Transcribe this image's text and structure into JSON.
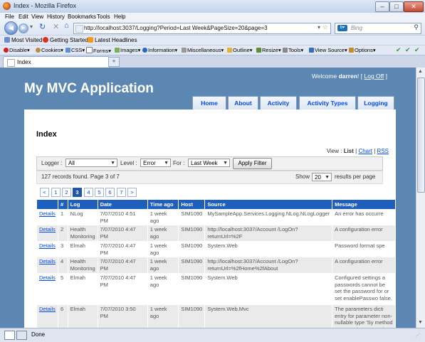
{
  "window": {
    "title": "Index - Mozilla Firefox",
    "buttons": {
      "minimize": "–",
      "maximize": "□",
      "close": "✕"
    }
  },
  "menu": [
    "File",
    "Edit",
    "View",
    "History",
    "Bookmarks",
    "Tools",
    "Help"
  ],
  "nav": {
    "url": "http://localhost:3037/Logging?Period=Last Week&PageSize=20&page=3",
    "search_placeholder": "Bing"
  },
  "bookmarks": [
    "Most Visited",
    "Getting Started",
    "Latest Headlines"
  ],
  "devtools": [
    "Disable",
    "Cookies",
    "CSS",
    "Forms",
    "Images",
    "Information",
    "Miscellaneous",
    "Outline",
    "Resize",
    "Tools",
    "View Source",
    "Options"
  ],
  "tab": {
    "label": "Index",
    "new_tab": "+"
  },
  "site": {
    "welcome": "Welcome",
    "user": "darren",
    "logoff": "Log Off",
    "bracket_open": "[",
    "bracket_close": "]",
    "title": "My MVC Application",
    "menu": [
      "Home",
      "About",
      "Activity",
      "Activity Types",
      "Logging"
    ]
  },
  "page": {
    "heading": "Index",
    "view_label": "View :",
    "view_list": "List",
    "view_chart": "Chart",
    "view_rss": "RSS",
    "filter": {
      "logger_label": "Logger :",
      "logger_value": "All",
      "level_label": "Level :",
      "level_value": "Error",
      "for_label": "For :",
      "for_value": "Last Week",
      "apply": "Apply Filter"
    },
    "info": {
      "records": "127 records found. Page 3 of 7",
      "show_label": "Show",
      "show_value": "20",
      "per_page": "results per page"
    },
    "pager": {
      "prev": "<",
      "next": ">",
      "pages": [
        "1",
        "2",
        "3",
        "4",
        "5",
        "6",
        "7"
      ],
      "current": "3"
    },
    "columns": [
      "",
      "#",
      "Log",
      "Date",
      "Time ago",
      "Host",
      "Source",
      "Message"
    ],
    "rows": [
      {
        "link": "Details",
        "num": "1",
        "log": "NLog",
        "date": "7/07/2010 4:51 PM",
        "ago": "1 week ago",
        "host": "SIM1090",
        "source": "MySampleApp.Services.Logging.NLog.NLogLogger",
        "message": "An error has occurre"
      },
      {
        "link": "Details",
        "num": "2",
        "log": "Health Monitoring",
        "date": "7/07/2010 4:47 PM",
        "ago": "1 week ago",
        "host": "SIM1090",
        "source": "http://localhost:3037/Account /LogOn?returnUrl=%2F",
        "message": "A configuration error"
      },
      {
        "link": "Details",
        "num": "3",
        "log": "Elmah",
        "date": "7/07/2010 4:47 PM",
        "ago": "1 week ago",
        "host": "SIM1090",
        "source": "System.Web",
        "message": "Password format spe"
      },
      {
        "link": "Details",
        "num": "4",
        "log": "Health Monitoring",
        "date": "7/07/2010 4:47 PM",
        "ago": "1 week ago",
        "host": "SIM1090",
        "source": "http://localhost:3037/Account /LogOn?returnUrl=%2fHome%2fAbout",
        "message": "A configuration error"
      },
      {
        "link": "Details",
        "num": "5",
        "log": "Elmah",
        "date": "7/07/2010 4:47 PM",
        "ago": "1 week ago",
        "host": "SIM1090",
        "source": "System.Web",
        "message": "Configured settings a passwords cannot be set the password for or set enablePasswo false."
      },
      {
        "link": "Details",
        "num": "6",
        "log": "Elmah",
        "date": "7/07/2010 3:50 PM",
        "ago": "1 week ago",
        "host": "SIM1090",
        "source": "System.Web.Mvc",
        "message": "The parameters dicti entry for parameter non-nullable type 'Sy method 'MySampleApp.Servic vCard(Int32)' in"
      }
    ]
  },
  "status": "Done"
}
